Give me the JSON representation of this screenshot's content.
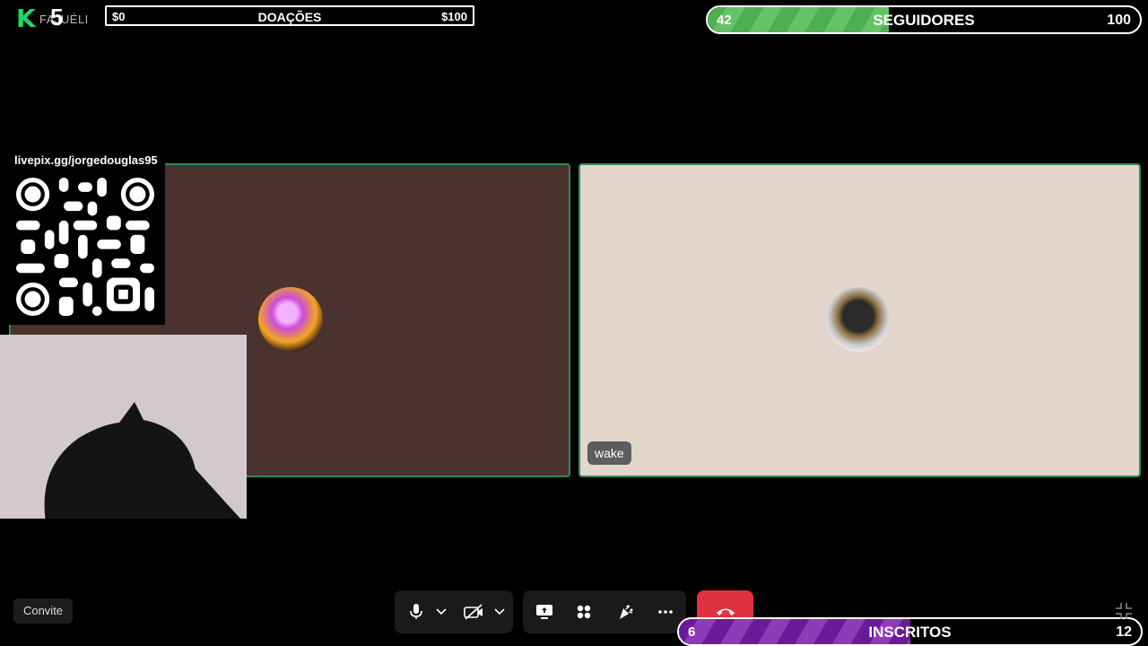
{
  "overlay": {
    "logo": {
      "letter": "K",
      "number": "5",
      "name": "FAJUÉLI",
      "accent": "#1ed760"
    },
    "donations": {
      "title": "DOAÇÕES",
      "min": "$0",
      "max": "$100",
      "progress": 0
    },
    "followers": {
      "title": "SEGUIDORES",
      "current": "42",
      "max": "100",
      "progress": 0.42,
      "color": "#4caf50"
    },
    "subscribers": {
      "title": "INSCRITOS",
      "current": "6",
      "max": "12",
      "progress": 0.5,
      "color": "#6a1b9a"
    },
    "pix": {
      "url": "livepix.gg/jorgedouglas95"
    }
  },
  "call": {
    "participants": [
      {
        "tile_color": "#4a332e"
      },
      {
        "name": "wake",
        "tile_color": "#e2d6ca"
      }
    ],
    "tile_border_color": "#2e8b57",
    "invite_label": "Convite",
    "controls": {
      "mic_icon": "microphone-icon",
      "camera_icon": "camera-off-icon",
      "share_icon": "screen-share-icon",
      "apps_icon": "apps-icon",
      "reactions_icon": "reactions-icon",
      "more_icon": "more-icon",
      "hangup_icon": "hang-up-icon",
      "hangup_color": "#e0313f"
    }
  }
}
